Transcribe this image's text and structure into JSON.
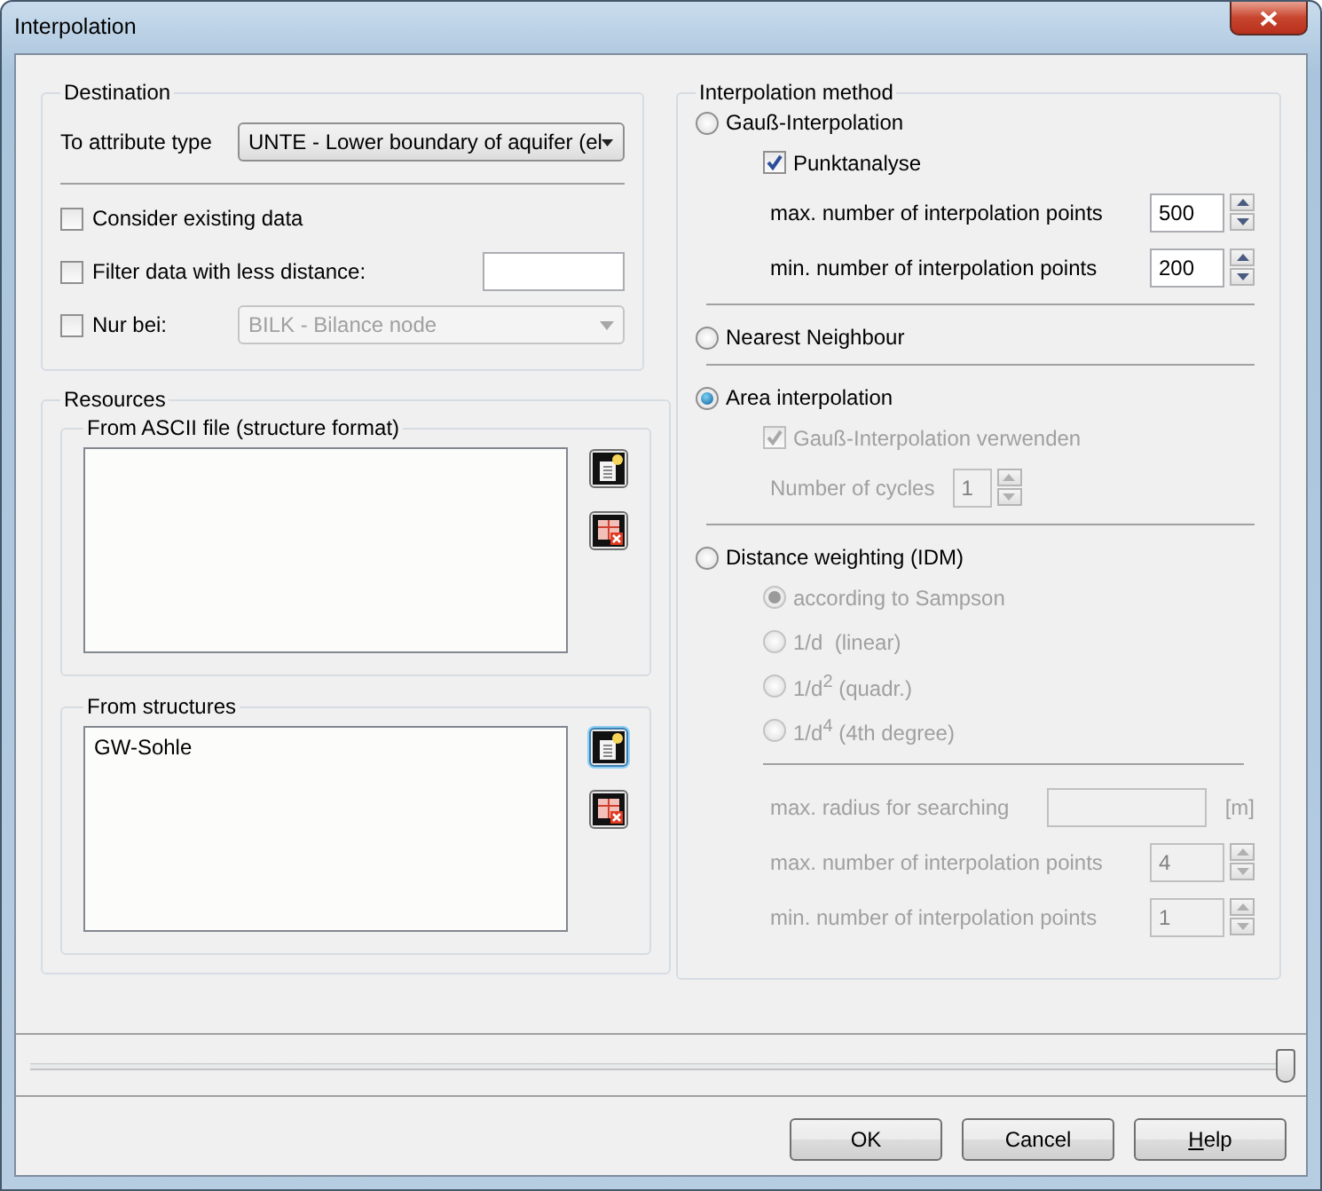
{
  "window": {
    "title": "Interpolation"
  },
  "destination": {
    "title": "Destination",
    "attribute_label": "To attribute type",
    "attribute_value": "UNTE - Lower boundary of aquifer (el",
    "options": [
      {
        "kind": "checkbox",
        "label": "Consider existing data",
        "checked": false
      },
      {
        "kind": "checkbox_field",
        "label": "Filter data with less distance:",
        "checked": false
      },
      {
        "kind": "checkbox_dropdown",
        "label": "Nur bei:",
        "checked": false,
        "value": "BILK - Bilance node",
        "disabled": true
      }
    ]
  },
  "resources": {
    "title": "Resources",
    "groups": [
      {
        "title": "From ASCII file (structure format)",
        "buttons": [
          {
            "kind": "add",
            "focused": false
          },
          {
            "kind": "remove",
            "focused": false
          }
        ]
      },
      {
        "title": "From structures",
        "items": [
          "GW-Sohle"
        ],
        "buttons": [
          {
            "kind": "add",
            "focused": true
          },
          {
            "kind": "remove",
            "focused": false
          }
        ]
      }
    ]
  },
  "method": {
    "title": "Interpolation method",
    "sections": [
      {
        "label": "Gauß-Interpolation",
        "selected": false,
        "controls": [
          {
            "kind": "checkbox",
            "label": "Punktanalyse",
            "checked": true,
            "disabled": false
          },
          {
            "kind": "spin",
            "label": "max. number of interpolation points",
            "value": "500",
            "disabled": false
          },
          {
            "kind": "spin",
            "label": "min. number of interpolation points",
            "value": "200",
            "disabled": false
          }
        ]
      },
      {
        "label": "Nearest Neighbour",
        "selected": false
      },
      {
        "label": "Area interpolation",
        "selected": true,
        "controls": [
          {
            "kind": "checkbox",
            "label": "Gauß-Interpolation verwenden",
            "checked": true,
            "disabled": true
          },
          {
            "kind": "spin_inline",
            "label": "Number of cycles",
            "value": "1",
            "disabled": true
          }
        ]
      },
      {
        "label": "Distance weighting (IDM)",
        "selected": false,
        "controls": [
          {
            "kind": "radio",
            "label": "according to Sampson",
            "selected": true,
            "disabled": true
          },
          {
            "kind": "radio",
            "label": "1/d  (linear)",
            "selected": false,
            "disabled": true
          },
          {
            "kind": "radio",
            "label": "1/d$^{2}$ (quadr.)",
            "selected": false,
            "disabled": true
          },
          {
            "kind": "radio",
            "label": "1/d$^{4}$ (4th degree)",
            "selected": false,
            "disabled": true
          },
          {
            "kind": "text_field",
            "label": "max. radius for searching",
            "unit": "[m]",
            "disabled": true
          },
          {
            "kind": "spin",
            "label": "max. number of interpolation points",
            "value": "4",
            "disabled": true
          },
          {
            "kind": "spin",
            "label": "min. number of interpolation points",
            "value": "1",
            "disabled": true
          }
        ]
      }
    ]
  },
  "slider": {
    "level": 1
  },
  "buttons": [
    {
      "label": "OK"
    },
    {
      "label": "Cancel"
    },
    {
      "label": "Help",
      "first_letter_underlined": true
    }
  ]
}
